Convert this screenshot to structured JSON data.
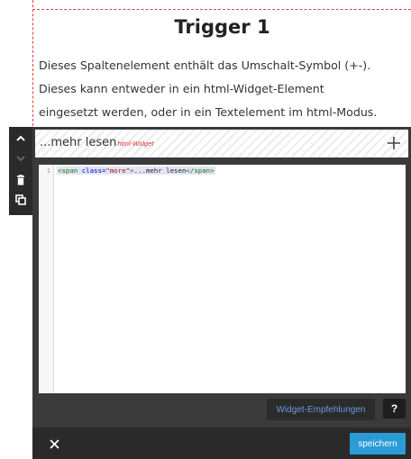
{
  "heading": "Trigger 1",
  "paragraph": {
    "lines": [
      "Dieses Spaltenelement enthält das Umschalt-Symbol (+-).",
      "Dieses kann entweder in ein html-Widget-Element",
      "eingesetzt werden, oder in ein Textelement im html-Modus."
    ]
  },
  "toolbar": {
    "icons": [
      "chevron-up-icon",
      "chevron-down-icon",
      "trash-icon",
      "copy-icon"
    ]
  },
  "widget": {
    "title": "...mehr lesen",
    "type_label": "html-Widget",
    "add_icon": "plus-icon"
  },
  "editor": {
    "line_number": "1",
    "code": {
      "tag_open_start": "<span ",
      "attr_name": "class=",
      "attr_value": "\"more\"",
      "tag_open_end": ">",
      "text": "...mehr lesen",
      "tag_close": "</span>"
    }
  },
  "buttons": {
    "recommendations": "Widget-Empfehlungen",
    "help": "?",
    "save": "speichern",
    "close_icon": "close-icon"
  },
  "colors": {
    "accent": "#2b9bd6",
    "frame": "#3a3a3a",
    "dashed_border": "#e04040",
    "widget_type": "#dd3333",
    "link_blue": "#6a9be0"
  }
}
